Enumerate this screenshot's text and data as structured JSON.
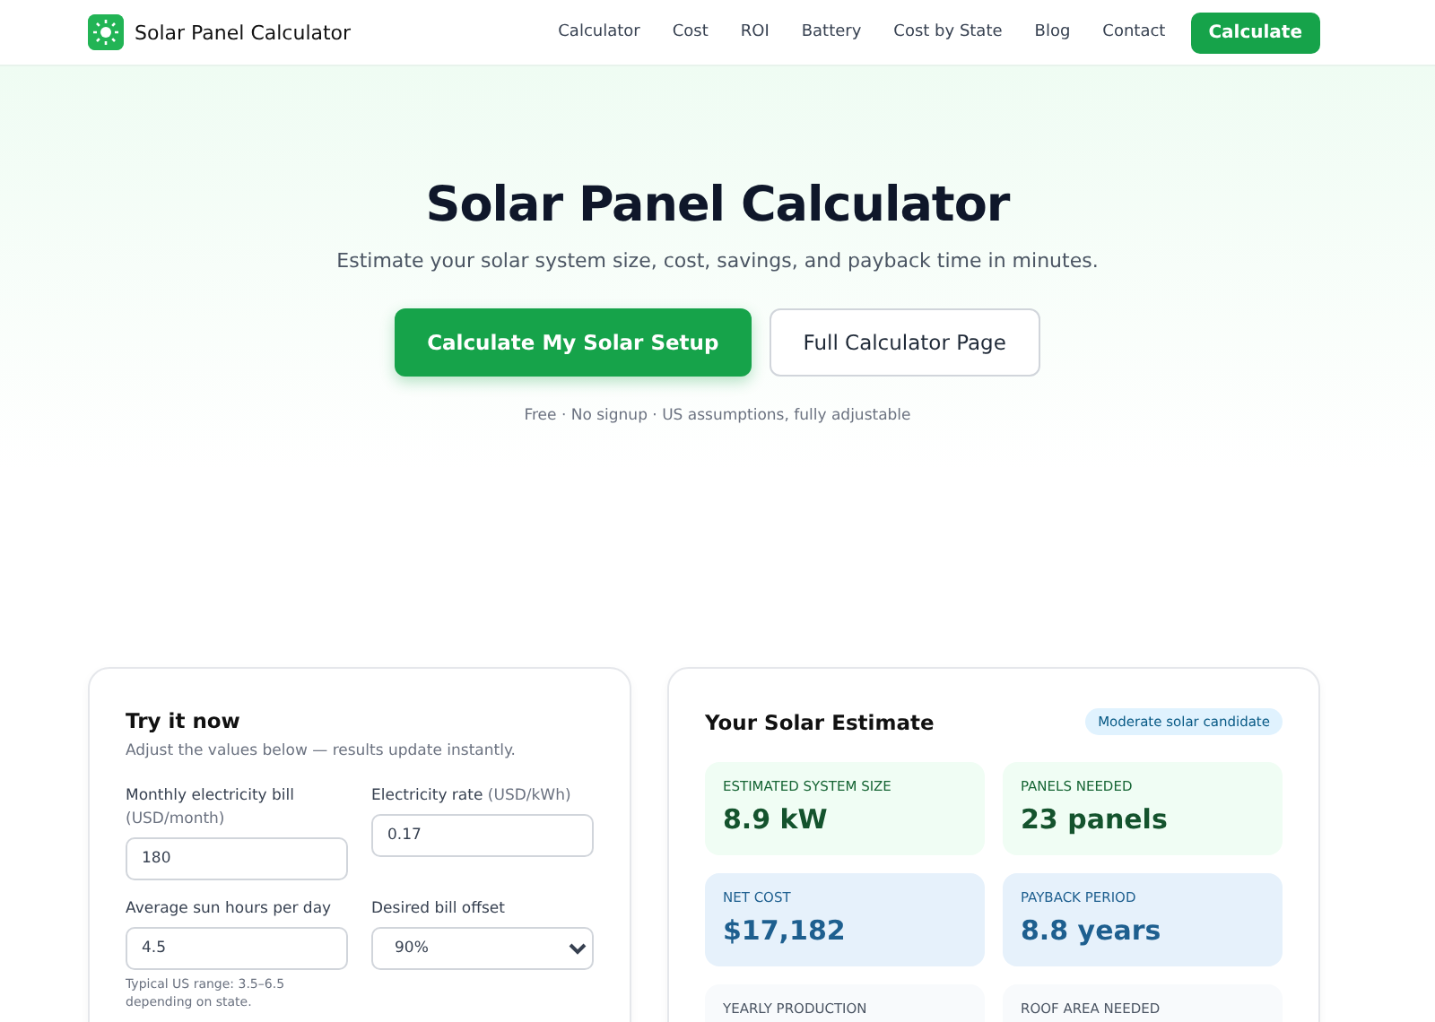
{
  "header": {
    "brand": "Solar Panel Calculator",
    "nav": [
      {
        "label": "Calculator",
        "kind": "link"
      },
      {
        "label": "Cost",
        "kind": "link"
      },
      {
        "label": "ROI",
        "kind": "link"
      },
      {
        "label": "Battery",
        "kind": "link"
      },
      {
        "label": "Cost by State",
        "kind": "link"
      },
      {
        "label": "Blog",
        "kind": "link"
      },
      {
        "label": "Contact",
        "kind": "link"
      },
      {
        "label": "Calculate",
        "kind": "button"
      }
    ]
  },
  "hero": {
    "title": "Solar Panel Calculator",
    "subtitle": "Estimate your solar system size, cost, savings, and payback time in minutes.",
    "buttons": [
      {
        "label": "Calculate My Solar Setup",
        "kind": "primary"
      },
      {
        "label": "Full Calculator Page",
        "kind": "secondary"
      }
    ],
    "note": "Free · No signup · US assumptions, fully adjustable"
  },
  "form": {
    "title": "Try it now",
    "subtitle": "Adjust the values below — results update instantly.",
    "fields": [
      {
        "label": "Monthly electricity bill",
        "unit": "(USD/month)",
        "value": "180",
        "kind": "input"
      },
      {
        "label": "Electricity rate",
        "unit": "(USD/kWh)",
        "value": "0.17",
        "kind": "input"
      },
      {
        "label": "Average sun hours per day",
        "value": "4.5",
        "kind": "input",
        "hint": "Typical US range: 3.5–6.5 depending on state."
      },
      {
        "label": "Desired bill offset",
        "value": "90%",
        "kind": "select"
      }
    ]
  },
  "estimate": {
    "title": "Your Solar Estimate",
    "badge": "Moderate solar candidate",
    "metrics": [
      {
        "label": "ESTIMATED SYSTEM SIZE",
        "value": "8.9 kW",
        "kind": "green"
      },
      {
        "label": "PANELS NEEDED",
        "value": "23 panels",
        "kind": "green"
      },
      {
        "label": "NET COST",
        "value": "$17,182",
        "kind": "blue"
      },
      {
        "label": "PAYBACK PERIOD",
        "value": "8.8 years",
        "kind": "blue"
      },
      {
        "label": "YEARLY PRODUCTION",
        "kind": "gray"
      },
      {
        "label": "ROOF AREA NEEDED",
        "kind": "gray"
      }
    ]
  }
}
